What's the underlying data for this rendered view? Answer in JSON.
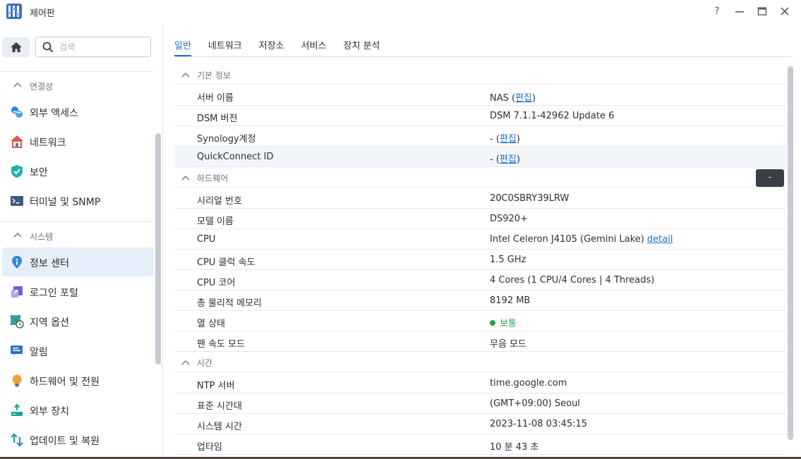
{
  "window": {
    "title": "제어판",
    "help_glyph": "?"
  },
  "sidebar": {
    "search_placeholder": "검색",
    "groups": [
      {
        "label": "연결성"
      },
      {
        "label": "시스템"
      }
    ],
    "items": [
      {
        "label": "외부 액세스",
        "icon": "external-access-icon"
      },
      {
        "label": "네트워크",
        "icon": "network-house-icon"
      },
      {
        "label": "보안",
        "icon": "shield-check-icon"
      },
      {
        "label": "터미널 및 SNMP",
        "icon": "terminal-icon"
      },
      {
        "label": "정보 센터",
        "icon": "info-pin-icon",
        "active": true
      },
      {
        "label": "로그인 포털",
        "icon": "login-portal-icon"
      },
      {
        "label": "지역 옵션",
        "icon": "regional-map-icon"
      },
      {
        "label": "알림",
        "icon": "notification-icon"
      },
      {
        "label": "하드웨어 및 전원",
        "icon": "bulb-icon"
      },
      {
        "label": "외부 장치",
        "icon": "external-device-icon"
      },
      {
        "label": "업데이트 및 복원",
        "icon": "update-restore-icon"
      }
    ]
  },
  "tabs": [
    {
      "label": "일반",
      "active": true
    },
    {
      "label": "네트워크"
    },
    {
      "label": "저장소"
    },
    {
      "label": "서비스"
    },
    {
      "label": "장치 분석"
    }
  ],
  "sections": {
    "basic": {
      "title": "기본 정보",
      "rows": [
        {
          "key": "서버 이름",
          "value": "NAS",
          "link": "편집"
        },
        {
          "key": "DSM 버전",
          "value": "DSM 7.1.1-42962 Update 6"
        },
        {
          "key": "Synology계정",
          "value": "-",
          "link": "편집"
        },
        {
          "key": "QuickConnect ID",
          "value": "-",
          "link": "편집"
        }
      ]
    },
    "hardware": {
      "title": "하드웨어",
      "rows": [
        {
          "key": "시리얼 번호",
          "value": "20C0SBRY39LRW"
        },
        {
          "key": "모델 이름",
          "value": "DS920+"
        },
        {
          "key": "CPU",
          "value": "Intel Celeron J4105 (Gemini Lake)",
          "link": "detail"
        },
        {
          "key": "CPU 클럭 속도",
          "value": "1.5 GHz"
        },
        {
          "key": "CPU 코어",
          "value": "4 Cores (1 CPU/4 Cores | 4 Threads)"
        },
        {
          "key": "총 물리적 메모리",
          "value": "8192 MB"
        },
        {
          "key": "열 상태",
          "value": "보통",
          "status_color": "#1fa34a"
        },
        {
          "key": "팬 속도 모드",
          "value": "무음 모드"
        }
      ]
    },
    "time": {
      "title": "시간",
      "rows": [
        {
          "key": "NTP 서버",
          "value": "time.google.com"
        },
        {
          "key": "표준 시간대",
          "value": "(GMT+09:00) Seoul"
        },
        {
          "key": "시스템 시간",
          "value": "2023-11-08 03:45:15"
        },
        {
          "key": "업타임",
          "value": "10 분 43 초"
        }
      ]
    }
  },
  "tooltip": {
    "text": "-"
  },
  "colors": {
    "accent": "#1d70c4",
    "status_ok": "#1fa34a",
    "active_bg": "#e5eef9"
  }
}
